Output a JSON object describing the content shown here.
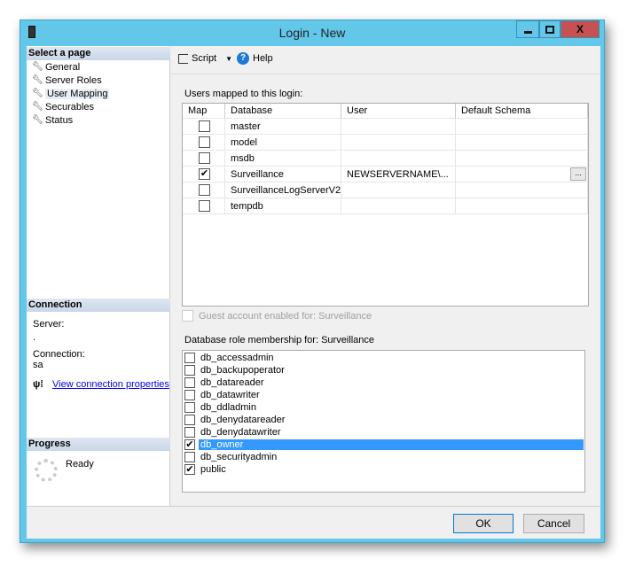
{
  "window": {
    "title": "Login - New",
    "minimize": "▁",
    "maximize": "☐",
    "close": "X"
  },
  "sidebar": {
    "header": "Select a page",
    "items": [
      {
        "label": "General"
      },
      {
        "label": "Server Roles"
      },
      {
        "label": "User Mapping",
        "selected": true
      },
      {
        "label": "Securables"
      },
      {
        "label": "Status"
      }
    ]
  },
  "connection": {
    "header": "Connection",
    "server_label": "Server:",
    "server_value": ".",
    "connection_label": "Connection:",
    "connection_value": "sa",
    "link": "View connection properties"
  },
  "progress": {
    "header": "Progress",
    "status": "Ready"
  },
  "toolbar": {
    "script": "Script",
    "help": "Help"
  },
  "users": {
    "label": "Users mapped to this login:",
    "columns": [
      "Map",
      "Database",
      "User",
      "Default Schema"
    ],
    "rows": [
      {
        "map": false,
        "database": "master",
        "user": "",
        "schema": ""
      },
      {
        "map": false,
        "database": "model",
        "user": "",
        "schema": ""
      },
      {
        "map": false,
        "database": "msdb",
        "user": "",
        "schema": ""
      },
      {
        "map": true,
        "database": "Surveillance",
        "user": "NEWSERVERNAME\\...",
        "schema": "",
        "browse": "..."
      },
      {
        "map": false,
        "database": "SurveillanceLogServerV2",
        "user": "",
        "schema": ""
      },
      {
        "map": false,
        "database": "tempdb",
        "user": "",
        "schema": ""
      }
    ]
  },
  "guest": {
    "label": "Guest account enabled for: Surveillance",
    "checked": false,
    "disabled": true
  },
  "roles": {
    "label": "Database role membership for: Surveillance",
    "items": [
      {
        "name": "db_accessadmin",
        "checked": false
      },
      {
        "name": "db_backupoperator",
        "checked": false
      },
      {
        "name": "db_datareader",
        "checked": false
      },
      {
        "name": "db_datawriter",
        "checked": false
      },
      {
        "name": "db_ddladmin",
        "checked": false
      },
      {
        "name": "db_denydatareader",
        "checked": false
      },
      {
        "name": "db_denydatawriter",
        "checked": false
      },
      {
        "name": "db_owner",
        "checked": true,
        "selected": true
      },
      {
        "name": "db_securityadmin",
        "checked": false
      },
      {
        "name": "public",
        "checked": true
      }
    ]
  },
  "footer": {
    "ok": "OK",
    "cancel": "Cancel"
  },
  "colors": {
    "titlebar": "#63c7ea",
    "close": "#c75050",
    "selection": "#3399ff",
    "link": "#0000ee"
  }
}
